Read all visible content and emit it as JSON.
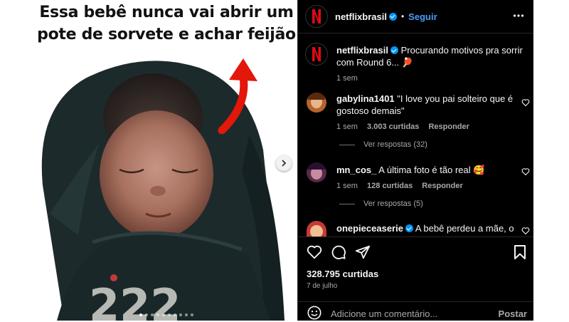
{
  "media": {
    "caption_line1": "Essa bebê nunca vai abrir um",
    "caption_line2": "pote de sorvete e achar feijão",
    "shirt_number": "222",
    "carousel_dots": 10,
    "active_dot": 0
  },
  "header": {
    "username": "netflixbrasil",
    "separator": "•",
    "follow_label": "Seguir",
    "more_icon": "ellipsis-icon"
  },
  "caption": {
    "username": "netflixbrasil",
    "text": "Procurando motivos pra sorrir com Round 6... 🏓",
    "time": "1 sem"
  },
  "comments": [
    {
      "username": "gabylina1401",
      "text": "\"I love you pai solteiro que é gostoso demais\"",
      "time": "1 sem",
      "likes": "3.003 curtidas",
      "reply_label": "Responder",
      "view_replies": "Ver respostas (32)",
      "avatar_color": "#b5652b"
    },
    {
      "username": "mn_cos_",
      "text": "A última foto é tão real 🥰",
      "time": "1 sem",
      "likes": "128 curtidas",
      "reply_label": "Responder",
      "view_replies": "Ver respostas (5)",
      "avatar_color": "#5a2a4a"
    },
    {
      "username": "onepieceaserie",
      "text": "A bebê perdeu a mãe, o",
      "avatar_color": "#c43a3a"
    }
  ],
  "actions": {
    "likes": "328.795 curtidas",
    "date": "7 de julho",
    "comment_placeholder": "Adicione um comentário...",
    "post_label": "Postar"
  },
  "colors": {
    "accent": "#0095f6",
    "panel_bg": "#000000",
    "arrow_red": "#e3170a",
    "netflix_red": "#e50914"
  }
}
